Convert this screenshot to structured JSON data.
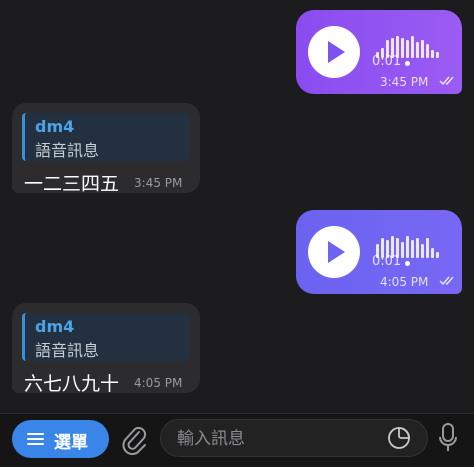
{
  "messages": [
    {
      "kind": "outgoing-voice",
      "duration": "0:01",
      "time": "3:45 PM",
      "status_icon": "double-check-icon"
    },
    {
      "kind": "incoming-reply",
      "reply_author": "dm4",
      "reply_text": "語音訊息",
      "text": "一二三四五",
      "time": "3:45 PM"
    },
    {
      "kind": "outgoing-voice",
      "duration": "0:01",
      "time": "4:05 PM",
      "status_icon": "double-check-icon"
    },
    {
      "kind": "incoming-reply",
      "reply_author": "dm4",
      "reply_text": "語音訊息",
      "text": "六七八九十",
      "time": "4:05 PM"
    }
  ],
  "bottom_bar": {
    "menu_label": "選單",
    "menu_icon": "hamburger-icon",
    "attach_icon": "paperclip-icon",
    "input_placeholder": "輸入訊息",
    "sticker_icon": "sticker-icon",
    "mic_icon": "microphone-icon"
  },
  "colors": {
    "background": "#1c1c1e",
    "voice_bubble_1": "#8a4cf0",
    "voice_bubble_2": "#6b63f0",
    "incoming_bubble": "#2c2c2e",
    "quote_accent": "#3a90d8",
    "menu_button": "#3a86e8"
  }
}
